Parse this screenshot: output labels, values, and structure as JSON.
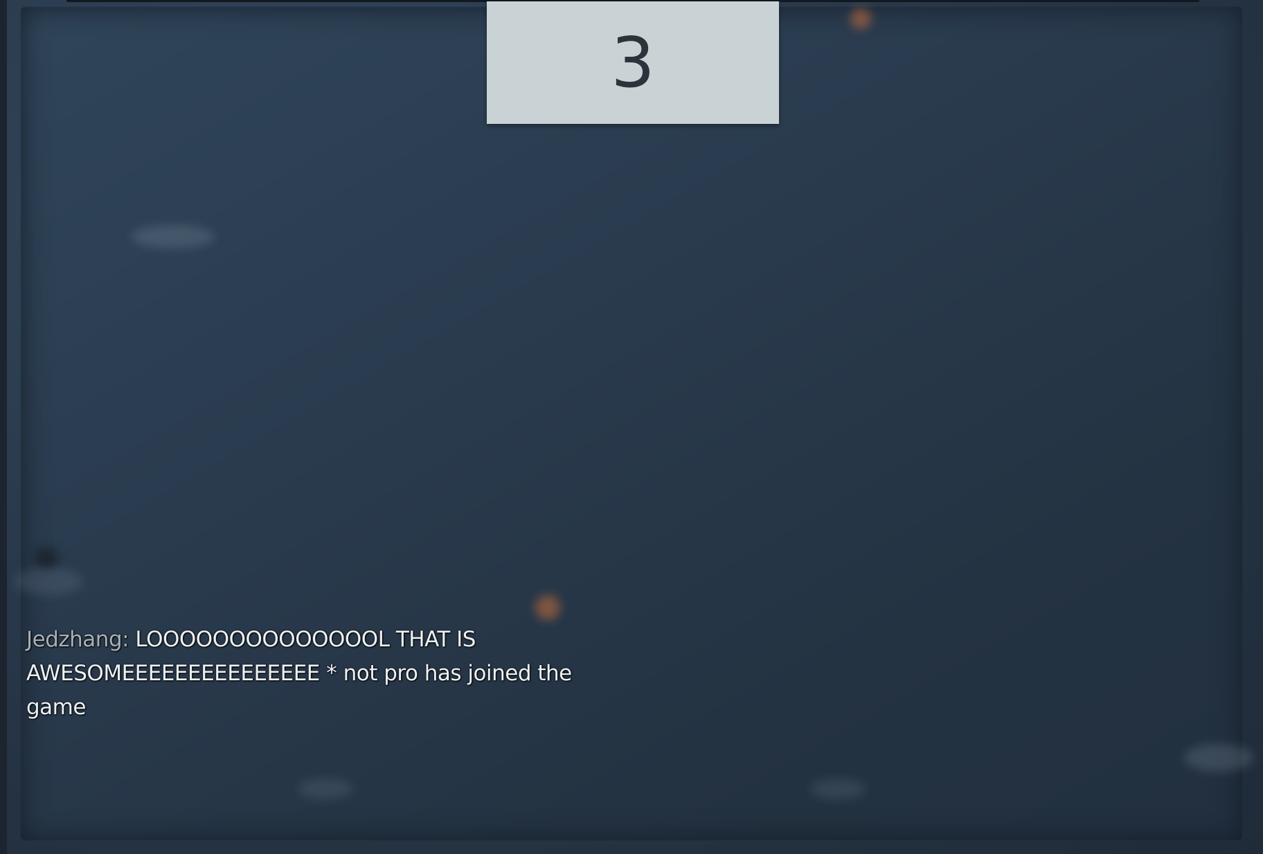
{
  "countdown": {
    "value": "3"
  },
  "chat": {
    "messages": [
      {
        "sender": "Jedzhang:",
        "text": " LOOOOOOOOOOOOOOL THAT IS AWESOMEEEEEEEEEEEEEEE"
      },
      {
        "text": " * not pro has joined the game"
      }
    ]
  },
  "colors": {
    "background": "#243242",
    "countdown_panel": "#c9d3d6",
    "countdown_text": "#2c333b",
    "chat_text": "#eef1f3",
    "chat_name": "#a9b0b6"
  }
}
